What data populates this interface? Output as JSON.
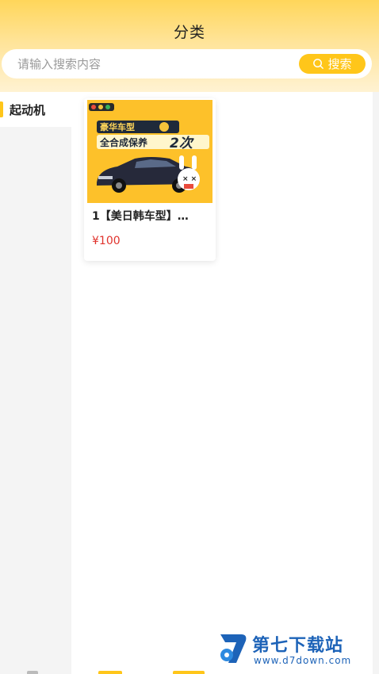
{
  "header": {
    "title": "分类",
    "search": {
      "placeholder": "请输入搜索内容",
      "value": "",
      "button_label": "搜索",
      "button_icon": "search-icon"
    }
  },
  "sidebar": {
    "items": [
      {
        "label": "起动机",
        "active": true
      }
    ]
  },
  "products": [
    {
      "title": "1【美日韩车型】…",
      "price": "¥100",
      "image": {
        "headline": "豪华车型",
        "subheadline": "全合成保养",
        "count": "2次"
      }
    }
  ],
  "watermark": {
    "name": "第七下载站",
    "url": "www.d7down.com"
  },
  "colors": {
    "accent": "#ffc61a",
    "header_top": "#ffd65a",
    "price": "#e0332d",
    "watermark": "#1d63b8"
  }
}
